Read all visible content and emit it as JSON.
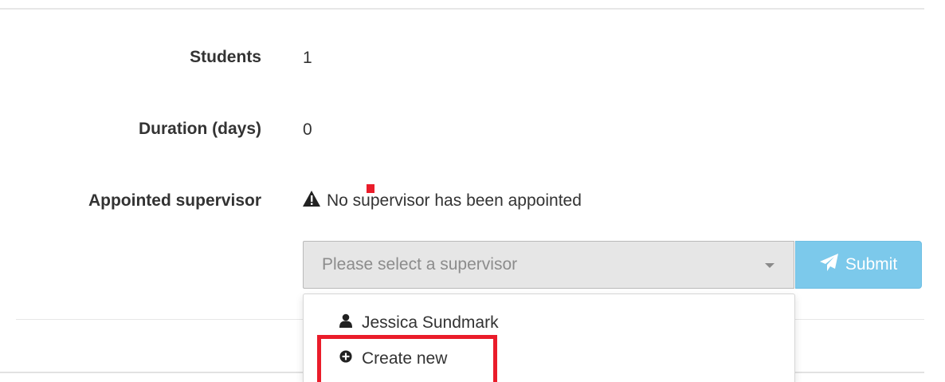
{
  "details": {
    "students_label": "Students",
    "students_value": "1",
    "duration_label": "Duration (days)",
    "duration_value": "0",
    "supervisor_label": "Appointed supervisor",
    "supervisor_status": "No supervisor has been appointed"
  },
  "supervisor_select": {
    "placeholder": "Please select a supervisor",
    "options": [
      {
        "label": "Jessica Sundmark",
        "icon": "user-icon"
      },
      {
        "label": "Create new",
        "icon": "plus-circle-icon"
      }
    ]
  },
  "submit": {
    "label": "Submit",
    "icon": "paper-plane-icon"
  },
  "colors": {
    "submit_bg": "#7cc9eb",
    "highlight": "#ea1c2a",
    "select_bg": "#e6e6e6"
  }
}
